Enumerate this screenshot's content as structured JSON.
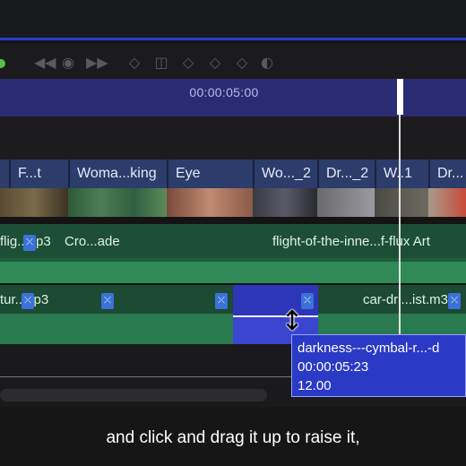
{
  "ruler": {
    "timecode": "00:00:05:00"
  },
  "toolbar": {
    "icons": [
      "rewind-icon",
      "record-icon",
      "fast-forward-icon",
      "keyframe-icon",
      "clip-icon",
      "keyframe-icon",
      "keyframe-icon",
      "keyframe-icon",
      "toggle-icon"
    ]
  },
  "video_track": {
    "clips": [
      "F...t",
      "Woma...king",
      "Eye",
      "Wo..._2",
      "Dr..._2",
      "W..1",
      "Dr..."
    ]
  },
  "audio_track_1": {
    "clip_a": "flig..mp3",
    "clip_b": "Cro...ade",
    "clip_c": "flight-of-the-inne...f-flux Art"
  },
  "audio_track_2": {
    "clip_a": "tur..mp3",
    "clip_b": "car-dri...ist.m3"
  },
  "tooltip": {
    "name": "darkness---cymbal-r...-d",
    "timecode": "00:00:05:23",
    "value": "12.00"
  },
  "caption": "and click and drag it up to raise it,",
  "colors": {
    "accent": "#2d3bd6",
    "ruler": "#2a2c73",
    "audio": "#2f8a58",
    "selection": "#2b39c7"
  }
}
